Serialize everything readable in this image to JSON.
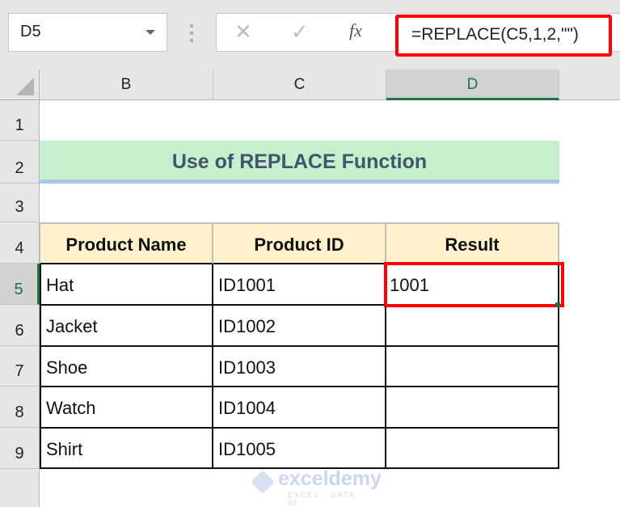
{
  "app": "Microsoft Excel",
  "name_box": {
    "value": "D5"
  },
  "formula_bar": {
    "cancel_icon": "x-icon",
    "enter_icon": "check-icon",
    "fx_label": "fx",
    "formula": "=REPLACE(C5,1,2,\"\")"
  },
  "columns": [
    "B",
    "C",
    "D"
  ],
  "selected_column": "D",
  "rows": [
    "1",
    "2",
    "3",
    "4",
    "5",
    "6",
    "7",
    "8",
    "9",
    ""
  ],
  "selected_row": "5",
  "sheet": {
    "title": "Use of REPLACE Function",
    "table": {
      "headers": [
        "Product Name",
        "Product ID",
        "Result"
      ],
      "rows": [
        [
          "Hat",
          "ID1001",
          "1001"
        ],
        [
          "Jacket",
          "ID1002",
          ""
        ],
        [
          "Shoe",
          "ID1003",
          ""
        ],
        [
          "Watch",
          "ID1004",
          ""
        ],
        [
          "Shirt",
          "ID1005",
          ""
        ]
      ]
    }
  },
  "highlight_color": "#ff0000",
  "title_fill": "#c6efce",
  "header_fill": "#fff2cc",
  "watermark": {
    "brand": "exceldemy",
    "tagline": "EXCEL · DATA · BI"
  }
}
